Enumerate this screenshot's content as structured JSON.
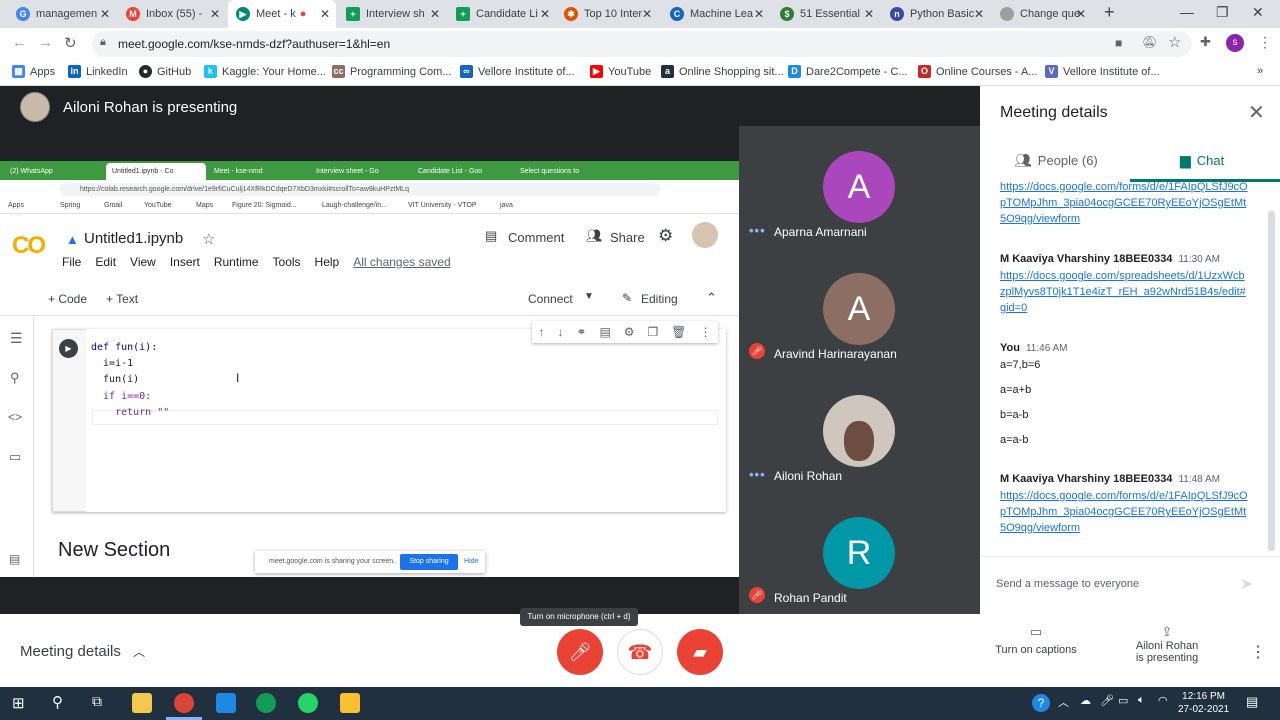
{
  "browser": {
    "tabs": [
      {
        "label": "managemen",
        "color": "#4285f4",
        "fav": "G"
      },
      {
        "label": "Inbox (55) - ",
        "color": "#ea4335",
        "fav": "M"
      },
      {
        "label": "Meet - k",
        "color": "#00897b",
        "fav": "▶"
      },
      {
        "label": "Interview sh",
        "color": "#0f9d58",
        "fav": "+"
      },
      {
        "label": "Candidate Li",
        "color": "#0f9d58",
        "fav": "+"
      },
      {
        "label": "Top 10 Inter",
        "color": "#e65100",
        "fav": "✱"
      },
      {
        "label": "Machine Lea",
        "color": "#1565c0",
        "fav": "C"
      },
      {
        "label": "51 Essential",
        "color": "#2e7d32",
        "fav": "$"
      },
      {
        "label": "Python Basic",
        "color": "#3949ab",
        "fav": "n"
      },
      {
        "label": "Change que",
        "color": "#9e9e9e",
        "fav": "·"
      }
    ],
    "new_tab": "+",
    "url": "meet.google.com/kse-nmds-dzf?authuser=1&hl=en",
    "profile_initial": "s",
    "bookmarks": [
      "Apps",
      "LinkedIn",
      "GitHub",
      "Kaggle: Your Home...",
      "Programming Com...",
      "Vellore Institute of...",
      "YouTube",
      "Online Shopping sit...",
      "Dare2Compete - C...",
      "Online Courses - A...",
      "Vellore Institute of..."
    ],
    "bookmark_overflow": "»"
  },
  "meet": {
    "presenter_text": "Ailoni Rohan is presenting",
    "shared_screen": {
      "tabs": [
        "(2) WhatsApp",
        "Untitled1.ipynb - Co",
        "Meet - kse-nmd",
        "Interview sheet - Go",
        "Candidate List - Goo",
        "Select questions to"
      ],
      "url": "https://colab.research.google.com/drive/1e9rfiCuCulj14XfRkDCdqeD7XbD3mxki#scrollTo=aw9kuHPztMLq",
      "bookmarks": [
        "Apps",
        "Spring",
        "Gmail",
        "YouTube",
        "Maps",
        "Figure 20: Sigmoid...",
        "Laugh-challenge/in...",
        "VIT University - VTOP",
        "java"
      ],
      "colab": {
        "logo": "CO",
        "title": "Untitled1.ipynb",
        "menu": [
          "File",
          "Edit",
          "View",
          "Insert",
          "Runtime",
          "Tools",
          "Help"
        ],
        "saved": "All changes saved",
        "comment": "Comment",
        "share": "Share",
        "add_code": "+ Code",
        "add_text": "+ Text",
        "connect": "Connect",
        "editing": "Editing",
        "code_lines": [
          "def fun(i):",
          "  i=i-1",
          "  fun(i)",
          "  if i==0:",
          "    return \"\""
        ],
        "new_section": "New Section"
      },
      "share_bar": {
        "text": "meet.google.com is sharing your screen.",
        "stop": "Stop sharing",
        "hide": "Hide"
      }
    },
    "participants": [
      {
        "name": "Aparna Amarnani",
        "initial": "A",
        "color": "#ab47bc",
        "status": "speaking"
      },
      {
        "name": "Aravind Harinarayanan",
        "initial": "A",
        "color": "#8d6e63",
        "status": "muted"
      },
      {
        "name": "Ailoni Rohan",
        "initial": "",
        "color": "#cfc6bd",
        "status": "speaking"
      },
      {
        "name": "Rohan Pandit",
        "initial": "R",
        "color": "#0097a7",
        "status": "muted"
      }
    ]
  },
  "panel": {
    "title": "Meeting details",
    "people_tab": "People (6)",
    "chat_tab": "Chat",
    "messages": [
      {
        "sender": "",
        "time": "",
        "link": "https://docs.google.com/forms/d/e/1FAIpQLSfJ9cOpTOMpJhm_3pia04ocgGCEE70RyEEoYjOSgEtMt5O9qg/viewform",
        "texts": []
      },
      {
        "sender": "M Kaaviya Vharshiny 18BEE0334",
        "time": "11:30 AM",
        "link": "https://docs.google.com/spreadsheets/d/1UzxWcbzplMyvs8T0jk1T1e4izT_rEH_a92wNrd51B4s/edit#gid=0",
        "texts": []
      },
      {
        "sender": "You",
        "time": "11:46 AM",
        "link": "",
        "texts": [
          "a=7,b=6",
          "a=a+b",
          "b=a-b",
          "a=a-b"
        ]
      },
      {
        "sender": "M Kaaviya Vharshiny 18BEE0334",
        "time": "11:48 AM",
        "link": "https://docs.google.com/forms/d/e/1FAIpQLSfJ9cOpTOMpJhm_3pia04ocgGCEE70RyEEoYjOSgEtMt5O9qg/viewform",
        "texts": []
      }
    ],
    "input_placeholder": "Send a message to everyone"
  },
  "bottom": {
    "meeting_details": "Meeting details",
    "tooltip": "Turn on microphone (ctrl + d)",
    "captions": "Turn on captions",
    "presenting_line1": "Ailoni Rohan",
    "presenting_line2": "is presenting"
  },
  "taskbar": {
    "time": "12:16 PM",
    "date": "27-02-2021"
  },
  "colors": {
    "danger": "#ea4335",
    "meet_dark": "#202124",
    "chat_accent": "#00796b",
    "link": "#1a73e8"
  }
}
